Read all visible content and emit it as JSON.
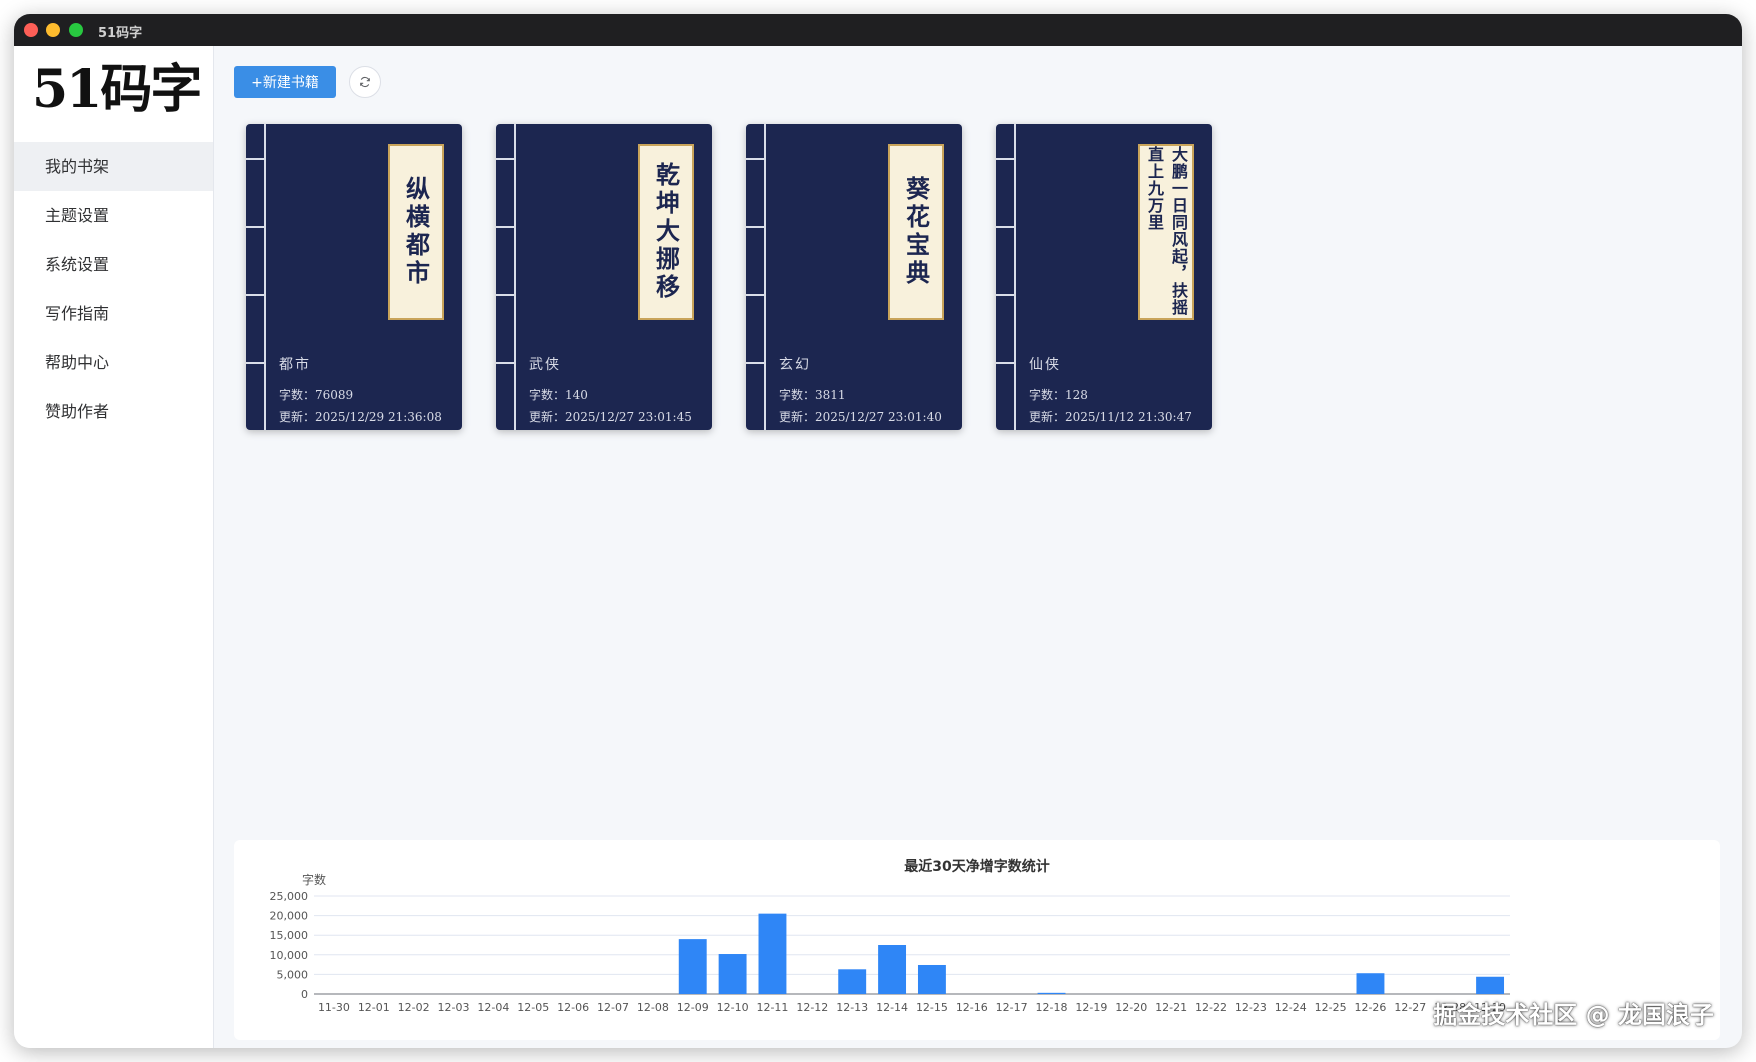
{
  "window": {
    "title": "51码字"
  },
  "sidebar": {
    "logo": "51码字",
    "items": [
      {
        "label": "我的书架",
        "active": true
      },
      {
        "label": "主题设置",
        "active": false
      },
      {
        "label": "系统设置",
        "active": false
      },
      {
        "label": "写作指南",
        "active": false
      },
      {
        "label": "帮助中心",
        "active": false
      },
      {
        "label": "赞助作者",
        "active": false
      }
    ]
  },
  "toolbar": {
    "new_book_label": "+新建书籍",
    "refresh_icon": "refresh-icon"
  },
  "books": [
    {
      "title": "纵横都市",
      "genre": "都市",
      "word_count_label": "字数：76089",
      "updated_label": "更新：2025/12/29 21:36:08"
    },
    {
      "title": "乾坤大挪移",
      "genre": "武侠",
      "word_count_label": "字数：140",
      "updated_label": "更新：2025/12/27 23:01:45"
    },
    {
      "title": "葵花宝典",
      "genre": "玄幻",
      "word_count_label": "字数：3811",
      "updated_label": "更新：2025/12/27 23:01:40"
    },
    {
      "title": "大鹏一日同风起，扶摇直上九万里",
      "genre": "仙侠",
      "word_count_label": "字数：128",
      "updated_label": "更新：2025/11/12 21:30:47"
    }
  ],
  "chart_data": {
    "type": "bar",
    "title": "最近30天净增字数统计",
    "ylabel": "字数",
    "xlabel": "",
    "ylim": [
      0,
      25000
    ],
    "yticks": [
      "0",
      "5,000",
      "10,000",
      "15,000",
      "20,000",
      "25,000"
    ],
    "categories": [
      "11-30",
      "12-01",
      "12-02",
      "12-03",
      "12-04",
      "12-05",
      "12-06",
      "12-07",
      "12-08",
      "12-09",
      "12-10",
      "12-11",
      "12-12",
      "12-13",
      "12-14",
      "12-15",
      "12-16",
      "12-17",
      "12-18",
      "12-19",
      "12-20",
      "12-21",
      "12-22",
      "12-23",
      "12-24",
      "12-25",
      "12-26",
      "12-27",
      "12-28",
      "12-29"
    ],
    "values": [
      0,
      0,
      0,
      0,
      0,
      0,
      0,
      0,
      0,
      14000,
      10200,
      20500,
      0,
      6300,
      12500,
      7400,
      0,
      0,
      300,
      0,
      0,
      0,
      0,
      0,
      0,
      0,
      5300,
      0,
      0,
      4400
    ],
    "color": "#2f86f6",
    "grid": true
  },
  "watermark": "掘金技术社区 @ 龙国浪子"
}
